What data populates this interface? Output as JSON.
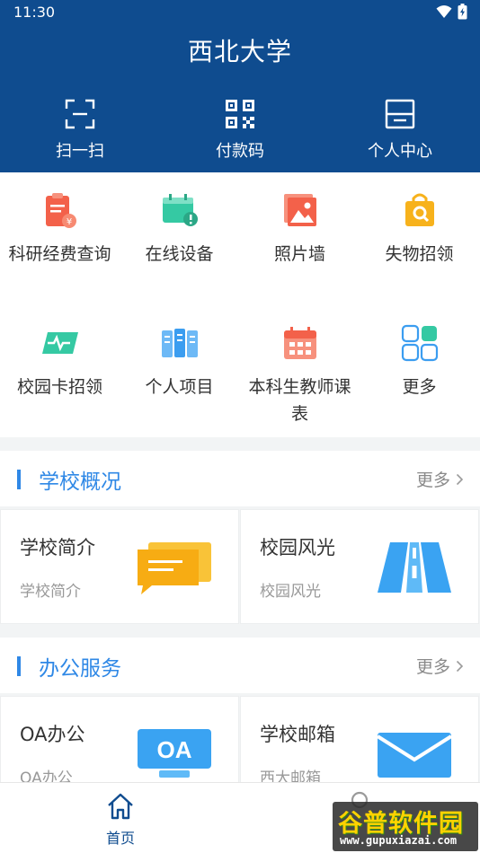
{
  "status_bar": {
    "time": "11:30"
  },
  "header": {
    "title": "西北大学"
  },
  "quick_actions": [
    {
      "label": "扫一扫",
      "icon": "scan-icon"
    },
    {
      "label": "付款码",
      "icon": "qr-code-icon"
    },
    {
      "label": "个人中心",
      "icon": "inbox-icon"
    }
  ],
  "grid": [
    {
      "label": "科研经费查询",
      "icon": "research-funds-icon",
      "color": "#f3614a"
    },
    {
      "label": "在线设备",
      "icon": "online-device-icon",
      "color": "#35c9a3"
    },
    {
      "label": "照片墙",
      "icon": "photo-wall-icon",
      "color": "#f3614a"
    },
    {
      "label": "失物招领",
      "icon": "lost-found-icon",
      "color": "#f7b21c"
    },
    {
      "label": "校园卡招领",
      "icon": "campus-card-icon",
      "color": "#35c9a3"
    },
    {
      "label": "个人项目",
      "icon": "projects-icon",
      "color": "#3b9df0"
    },
    {
      "label": "本科生教师课表",
      "icon": "timetable-icon",
      "color": "#f3614a"
    },
    {
      "label": "更多",
      "icon": "more-apps-icon",
      "color": "#3b9df0"
    }
  ],
  "sections": [
    {
      "title": "学校概况",
      "more": "更多",
      "cards": [
        {
          "title": "学校简介",
          "subtitle": "学校简介",
          "icon": "chat-bubbles-icon"
        },
        {
          "title": "校园风光",
          "subtitle": "校园风光",
          "icon": "road-icon"
        }
      ]
    },
    {
      "title": "办公服务",
      "more": "更多",
      "cards": [
        {
          "title": "OA办公",
          "subtitle": "OA办公",
          "icon": "oa-monitor-icon"
        },
        {
          "title": "学校邮箱",
          "subtitle": "西大邮箱",
          "icon": "mail-icon"
        }
      ]
    }
  ],
  "tabbar": {
    "home_label": "首页"
  },
  "watermark": {
    "name": "谷普软件园",
    "url": "www.gupuxiazai.com"
  },
  "colors": {
    "brand": "#0f4c8f",
    "accent": "#2f88e6"
  }
}
